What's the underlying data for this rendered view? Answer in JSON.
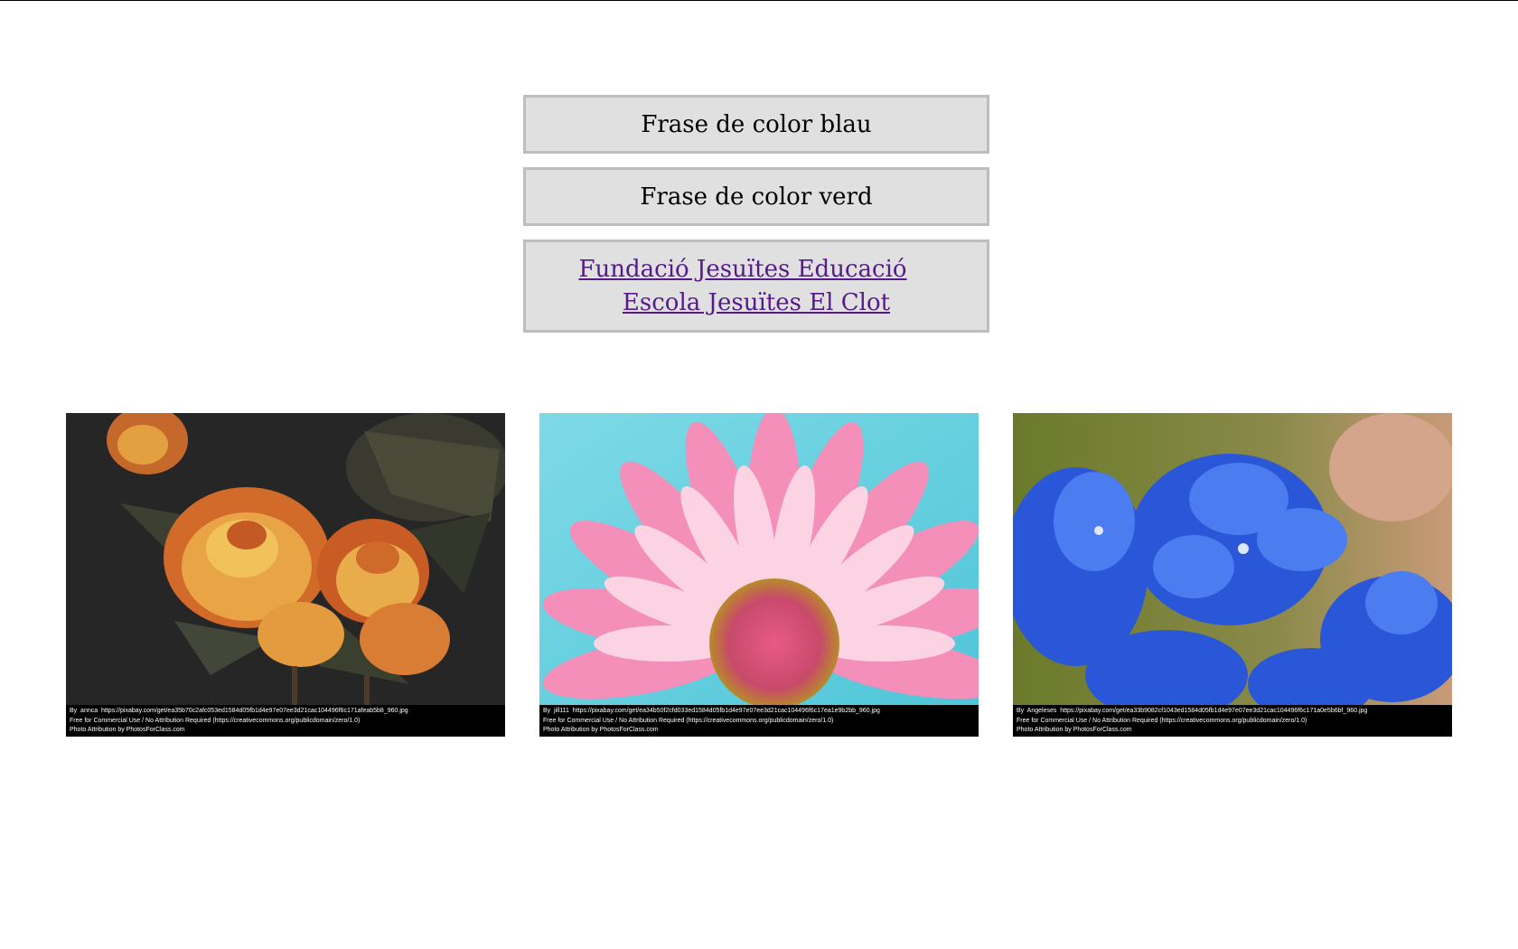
{
  "buttons": {
    "blue": "Frase de color blau",
    "green": "Frase de color verd"
  },
  "links": {
    "fundacio": "Fundació Jesuïtes Educació",
    "escola": "Escola Jesuïtes El Clot"
  },
  "photos": [
    {
      "subject": "orange-roses",
      "caption_line1": "By  annca  https://pixabay.com/get/ea35b70c2afc053ed1584d05fb1d4e97e07ee3d21cac104496f6c171afeab5b8_960.jpg",
      "caption_line2": "Free for Commercial Use / No Attribution Required (https://creativecommons.org/publicdomain/zero/1.0)",
      "caption_line3": "Photo Attribution by PhotosForClass.com"
    },
    {
      "subject": "pink-daisy",
      "caption_line1": "By  jill111  https://pixabay.com/get/ea34b50f2cfd033ed1584d05fb1d4e97e07ee3d21cac104496f6c17ea1e9b2bb_960.jpg",
      "caption_line2": "Free for Commercial Use / No Attribution Required (https://creativecommons.org/publicdomain/zero/1.0)",
      "caption_line3": "Photo Attribution by PhotosForClass.com"
    },
    {
      "subject": "blue-plumbago",
      "caption_line1": "By  Angeleses  https://pixabay.com/get/ea33b9082cf1043ed1584d05fb1d4e97e07ee3d21cac104496f6c171a0e5b6bf_960.jpg",
      "caption_line2": "Free for Commercial Use / No Attribution Required (https://creativecommons.org/publicdomain/zero/1.0)",
      "caption_line3": "Photo Attribution by PhotosForClass.com"
    }
  ],
  "colors": {
    "button_bg": "#e0e0e0",
    "button_border": "#bdbdbd",
    "link": "#551a8b"
  }
}
